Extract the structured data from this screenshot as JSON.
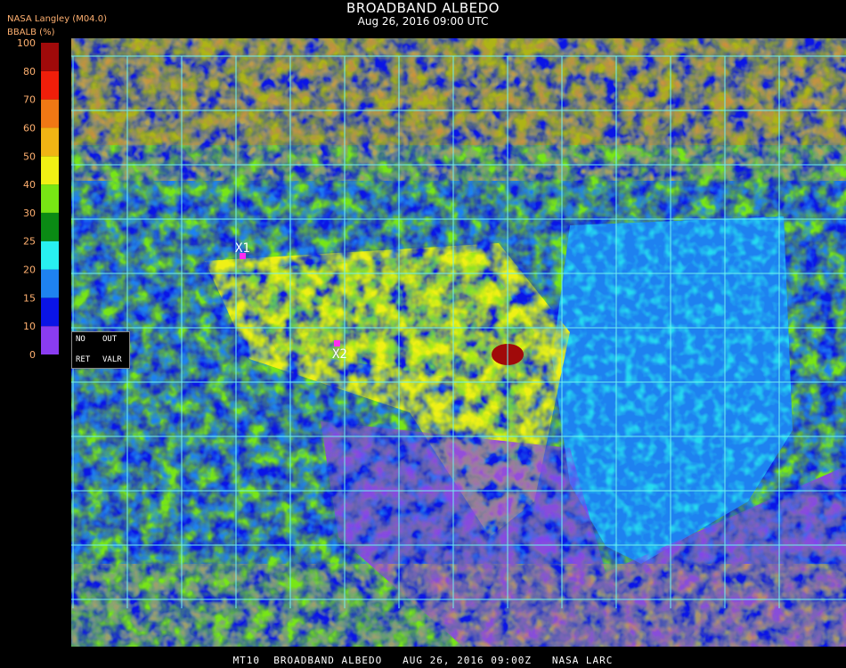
{
  "header": {
    "title": "BROADBAND ALBEDO",
    "subtitle": "Aug 26, 2016 09:00 UTC",
    "org": "NASA Langley (M04.0)"
  },
  "colorbar": {
    "label": "BBALB (%)",
    "ticks": [
      "100",
      "80",
      "70",
      "60",
      "50",
      "40",
      "30",
      "25",
      "20",
      "15",
      "10",
      "0"
    ],
    "bands": [
      {
        "range": [
          0,
          10
        ],
        "color": "#8a3cf0"
      },
      {
        "range": [
          10,
          15
        ],
        "color": "#0a14e6"
      },
      {
        "range": [
          15,
          20
        ],
        "color": "#1e82f0"
      },
      {
        "range": [
          20,
          25
        ],
        "color": "#28f0f0"
      },
      {
        "range": [
          25,
          30
        ],
        "color": "#0a8a14"
      },
      {
        "range": [
          30,
          40
        ],
        "color": "#78e614"
      },
      {
        "range": [
          40,
          50
        ],
        "color": "#f0f014"
      },
      {
        "range": [
          50,
          60
        ],
        "color": "#f0b414"
      },
      {
        "range": [
          60,
          70
        ],
        "color": "#f07814"
      },
      {
        "range": [
          70,
          80
        ],
        "color": "#f01e0a"
      },
      {
        "range": [
          80,
          100
        ],
        "color": "#a00a0a"
      }
    ]
  },
  "status_box": {
    "no": "NO",
    "out": "OUT",
    "ret": "RET",
    "valr": "VALR"
  },
  "markers": [
    {
      "label": "X1",
      "color": "#ff2cf0"
    },
    {
      "label": "X2",
      "color": "#ff2cf0"
    }
  ],
  "grid_color": "#6ff0f0",
  "footer": "MT10  BROADBAND ALBEDO   AUG 26, 2016 09:00Z   NASA LARC"
}
